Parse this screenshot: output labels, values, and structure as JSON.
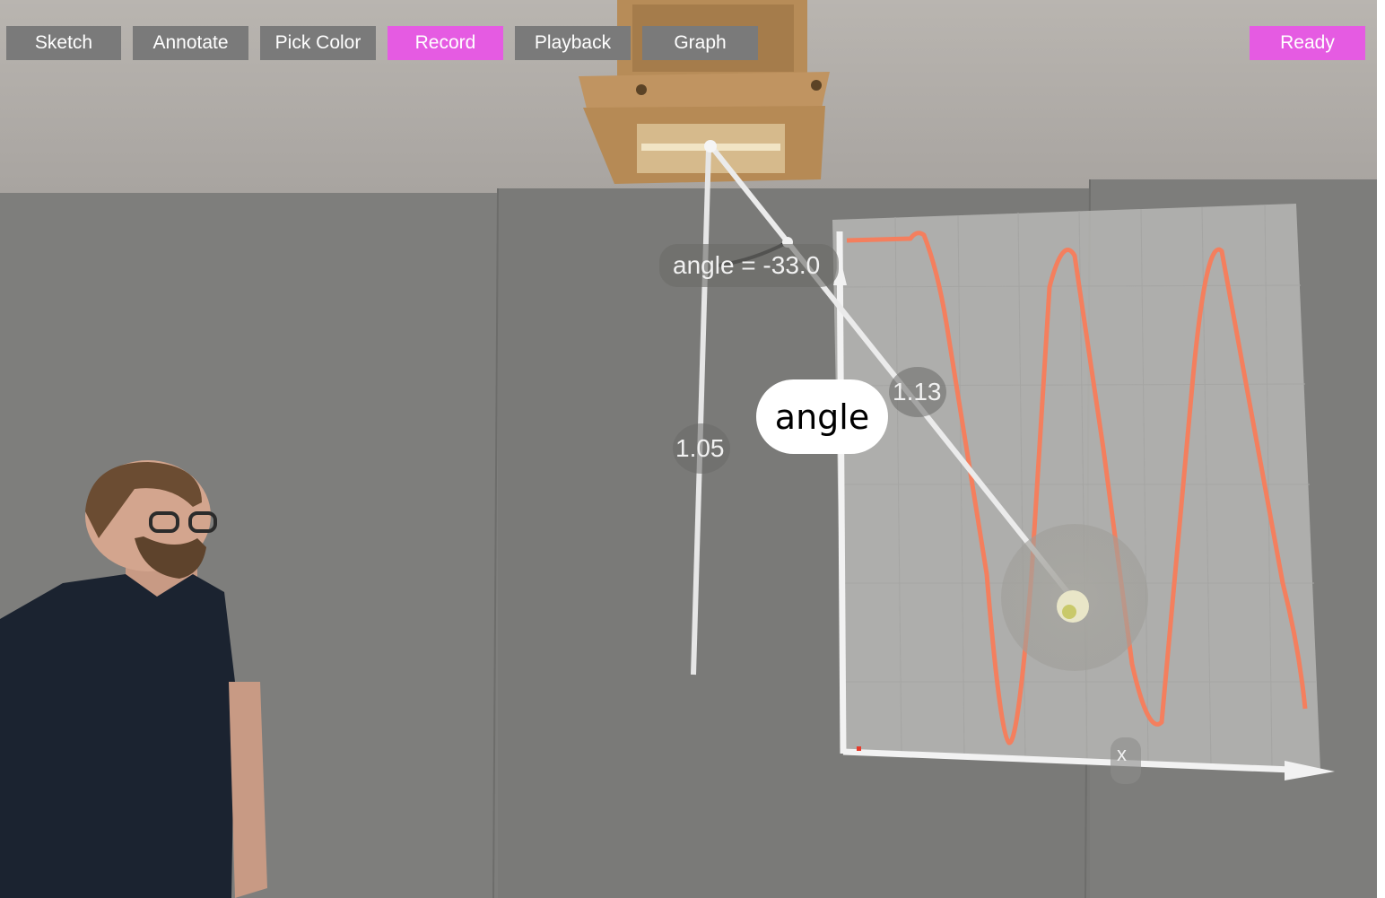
{
  "toolbar": {
    "buttons": [
      {
        "label": "Sketch",
        "active": false
      },
      {
        "label": "Annotate",
        "active": false
      },
      {
        "label": "Pick Color",
        "active": false
      },
      {
        "label": "Record",
        "active": true
      },
      {
        "label": "Playback",
        "active": false
      },
      {
        "label": "Graph",
        "active": false
      }
    ],
    "status": {
      "label": "Ready",
      "active": true
    }
  },
  "ar_overlay": {
    "angle_readout": "angle = -33.0",
    "vertical_length": "1.05",
    "pendulum_length": "1.13",
    "graph_label": "angle",
    "x_axis_label": "x"
  },
  "colors": {
    "active_button": "#e55be2",
    "inactive_button": "#7a7a7a",
    "trace": "#f47f5e",
    "wall": "#7c7c7a"
  }
}
